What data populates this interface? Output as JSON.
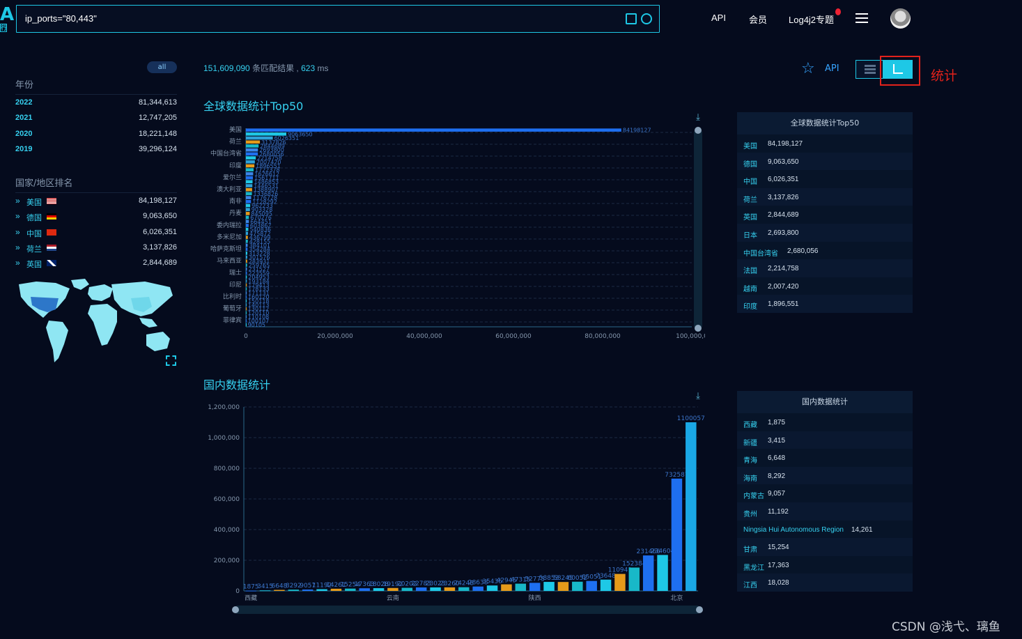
{
  "search": {
    "query": "ip_ports=\"80,443\""
  },
  "logo": {
    "letter": "A",
    "sub": "行"
  },
  "nav": {
    "api": "API",
    "member": "会员",
    "log4j": "Log4j2专题"
  },
  "filter": {
    "all": "all"
  },
  "years": {
    "title": "年份",
    "items": [
      {
        "label": "2022",
        "value": "81,344,613"
      },
      {
        "label": "2021",
        "value": "12,747,205"
      },
      {
        "label": "2020",
        "value": "18,221,148"
      },
      {
        "label": "2019",
        "value": "39,296,124"
      }
    ]
  },
  "countries": {
    "title": "国家/地区排名",
    "items": [
      {
        "label": "美国",
        "value": "84,198,127",
        "flag": "us"
      },
      {
        "label": "德国",
        "value": "9,063,650",
        "flag": "de"
      },
      {
        "label": "中国",
        "value": "6,026,351",
        "flag": "cn"
      },
      {
        "label": "荷兰",
        "value": "3,137,826",
        "flag": "nl"
      },
      {
        "label": "英国",
        "value": "2,844,689",
        "flag": "gb"
      }
    ]
  },
  "stats": {
    "count": "151,609,090",
    "count_suffix": "条匹配结果 ,",
    "time": "623",
    "time_unit": "ms"
  },
  "toolbar": {
    "api": "API",
    "stat_label": "统计"
  },
  "global_title": "全球数据统计Top50",
  "domestic_title": "国内数据统计",
  "global_table": {
    "title": "全球数据统计Top50",
    "rows": [
      {
        "k": "美国",
        "v": "84,198,127"
      },
      {
        "k": "德国",
        "v": "9,063,650"
      },
      {
        "k": "中国",
        "v": "6,026,351"
      },
      {
        "k": "荷兰",
        "v": "3,137,826"
      },
      {
        "k": "英国",
        "v": "2,844,689"
      },
      {
        "k": "日本",
        "v": "2,693,800"
      },
      {
        "k": "中国台湾省",
        "v": "2,680,056"
      },
      {
        "k": "法国",
        "v": "2,214,758"
      },
      {
        "k": "越南",
        "v": "2,007,420"
      },
      {
        "k": "印度",
        "v": "1,896,551"
      }
    ]
  },
  "domestic_table": {
    "title": "国内数据统计",
    "rows": [
      {
        "k": "西藏",
        "v": "1,875"
      },
      {
        "k": "新疆",
        "v": "3,415"
      },
      {
        "k": "青海",
        "v": "6,648"
      },
      {
        "k": "海南",
        "v": "8,292"
      },
      {
        "k": "内蒙古",
        "v": "9,057"
      },
      {
        "k": "贵州",
        "v": "11,192"
      },
      {
        "k": "Ningsia Hui Autonomous Region",
        "v": "14,261"
      },
      {
        "k": "甘肃",
        "v": "15,254"
      },
      {
        "k": "黑龙江",
        "v": "17,363"
      },
      {
        "k": "江西",
        "v": "18,028"
      }
    ]
  },
  "watermark": "CSDN @浅弋、璃鱼",
  "chart_data": [
    {
      "type": "bar",
      "orientation": "horizontal",
      "title": "全球数据统计Top50",
      "xlim": [
        0,
        100000000
      ],
      "xticks": [
        "0",
        "20,000,000",
        "40,000,000",
        "60,000,000",
        "80,000,000",
        "100,000,0"
      ],
      "category_labels": [
        "美国",
        "荷兰",
        "中国台湾省",
        "印度",
        "爱尔兰",
        "澳大利亚",
        "南非",
        "丹麦",
        "委内瑞拉",
        "多米尼加",
        "哈萨克斯坦",
        "马来西亚",
        "瑞士",
        "印尼",
        "比利时",
        "葡萄牙",
        "菲律宾"
      ],
      "values": [
        84198127,
        9063650,
        6026351,
        3137826,
        2844689,
        2693800,
        2680056,
        2214758,
        2007420,
        1896551,
        1722378,
        1626612,
        1561711,
        1486853,
        1446531,
        1388907,
        1336826,
        1176728,
        1128292,
        962233,
        903328,
        845095,
        670276,
        664451,
        603862,
        540836,
        475872,
        436799,
        428155,
        384101,
        354284,
        313228,
        301576,
        283931,
        259765,
        231527,
        223559,
        204953,
        193184,
        179413,
        178133,
        171131,
        160120,
        150118,
        140113,
        130112,
        120110,
        110108,
        100107,
        90105
      ],
      "labels_shown": [
        "84198127",
        "9063650",
        "6026351"
      ]
    },
    {
      "type": "bar",
      "title": "国内数据统计",
      "ylim": [
        0,
        1200000
      ],
      "yticks": [
        "0",
        "200,000",
        "400,000",
        "600,000",
        "800,000",
        "1,000,000",
        "1,200,000"
      ],
      "category_labels": [
        "西藏",
        "云南",
        "陕西",
        "北京"
      ],
      "values": [
        1875,
        3415,
        6648,
        8292,
        9057,
        11192,
        14261,
        15254,
        17363,
        18028,
        19192,
        20202,
        22783,
        23023,
        23260,
        24248,
        28638,
        35436,
        42945,
        47315,
        52775,
        58853,
        58245,
        60052,
        65051,
        73648,
        110941,
        152384,
        231466,
        234604,
        732587,
        1100057
      ],
      "value_labels": [
        "1875",
        "3415",
        "6648",
        "8292",
        "9057",
        "11192",
        "14261",
        "15254",
        "17363",
        "18028",
        "19192",
        "20202",
        "22783",
        "23023",
        "23260",
        "24248",
        "28638",
        "35436",
        "42945",
        "47315",
        "52775",
        "58853",
        "58245",
        "60052",
        "65051",
        "73648",
        "110941",
        "152384",
        "231466",
        "234604",
        "732587",
        "1100057"
      ]
    }
  ]
}
